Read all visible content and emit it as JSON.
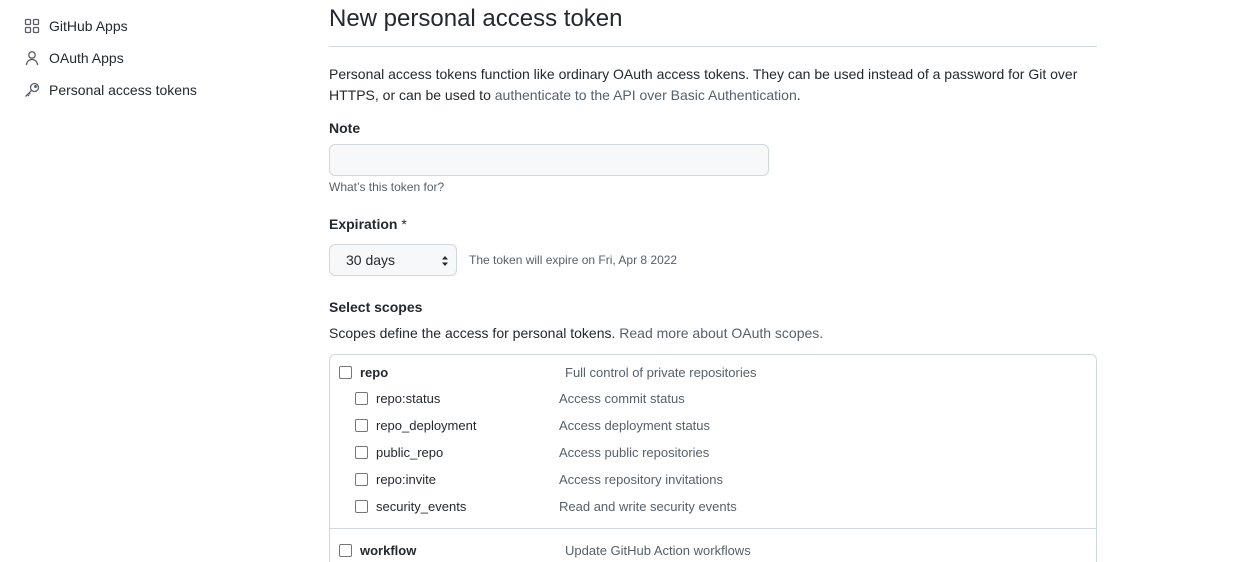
{
  "sidebar": {
    "items": [
      {
        "label": "GitHub Apps",
        "icon": "apps-grid-icon"
      },
      {
        "label": "OAuth Apps",
        "icon": "person-icon"
      },
      {
        "label": "Personal access tokens",
        "icon": "key-icon"
      }
    ]
  },
  "main": {
    "title": "New personal access token",
    "intro_text": "Personal access tokens function like ordinary OAuth access tokens. They can be used instead of a password for Git over HTTPS, or can be used to ",
    "intro_link": "authenticate to the API over Basic Authentication",
    "intro_end": ".",
    "note": {
      "label": "Note",
      "value": "",
      "hint": "What’s this token for?"
    },
    "expiration": {
      "label": "Expiration",
      "required_mark": "*",
      "selected": "30 days",
      "note": "The token will expire on Fri, Apr 8 2022"
    },
    "scopes": {
      "label": "Select scopes",
      "desc_text": "Scopes define the access for personal tokens. ",
      "desc_link": "Read more about OAuth scopes.",
      "repo": {
        "name": "repo",
        "desc": "Full control of private repositories",
        "children": [
          {
            "name": "repo:status",
            "desc": "Access commit status"
          },
          {
            "name": "repo_deployment",
            "desc": "Access deployment status"
          },
          {
            "name": "public_repo",
            "desc": "Access public repositories"
          },
          {
            "name": "repo:invite",
            "desc": "Access repository invitations"
          },
          {
            "name": "security_events",
            "desc": "Read and write security events"
          }
        ]
      },
      "workflow": {
        "name": "workflow",
        "desc": "Update GitHub Action workflows"
      }
    }
  },
  "colors": {
    "text": "#24292f",
    "muted": "#57606a",
    "border": "#d0d7de",
    "input_bg": "#f6f8fa"
  }
}
